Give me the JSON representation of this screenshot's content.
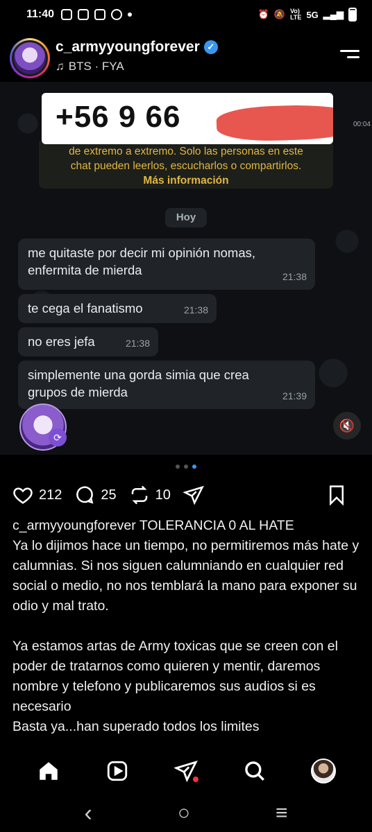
{
  "status_bar": {
    "time": "11:40",
    "right_icons": [
      "alarm-icon",
      "mute-icon",
      "volte-icon",
      "5g-icon",
      "signal-icon",
      "battery-icon"
    ],
    "network": "5G"
  },
  "header": {
    "username": "c_armyyoungforever",
    "verified": true,
    "music": "BTS · FYA"
  },
  "post_image": {
    "phone_number": "+56 9 66",
    "side_time": "00:04",
    "encryption_text_line1": "de extremo a extremo. Solo las personas en este",
    "encryption_text_line2": "chat pueden leerlos, escucharlos o compartirlos.",
    "encryption_link": "Más información",
    "day_chip": "Hoy",
    "messages": [
      {
        "line1": "me quitaste por decir mi opinión nomas,",
        "line2": "enfermita de mierda",
        "time": "21:38"
      },
      {
        "line1": "te cega el fanatismo",
        "line2": "",
        "time": "21:38"
      },
      {
        "line1": "no eres jefa",
        "line2": "",
        "time": "21:38"
      },
      {
        "line1": "simplemente una gorda simia que crea",
        "line2": "grupos de mierda",
        "time": "21:39"
      }
    ],
    "accent_color": "#e2b743",
    "redaction_color": "#e8574f"
  },
  "carousel": {
    "count": 3,
    "active_index": 2
  },
  "actions": {
    "likes": "212",
    "comments": "25",
    "reposts": "10"
  },
  "caption": {
    "username": "c_armyyoungforever",
    "title": "TOLERANCIA 0 AL HATE",
    "para1": "Ya lo dijimos hace un tiempo, no permitiremos más hate y calumnias. Si nos siguen calumniando en cualquier red social o medio, no nos temblará la mano para exponer su odio y mal trato.",
    "para2": "Ya estamos artas de Army toxicas que se creen con el poder de tratarnos como quieren y mentir, daremos nombre y telefono y publicaremos sus audios si es necesario",
    "para3": "Basta ya...han superado todos los limites"
  },
  "bottom_nav": [
    "home-icon",
    "reels-icon",
    "send-icon",
    "search-icon",
    "profile-avatar"
  ],
  "system_nav": {
    "back": "‹",
    "home": "○",
    "recents": "≡"
  }
}
